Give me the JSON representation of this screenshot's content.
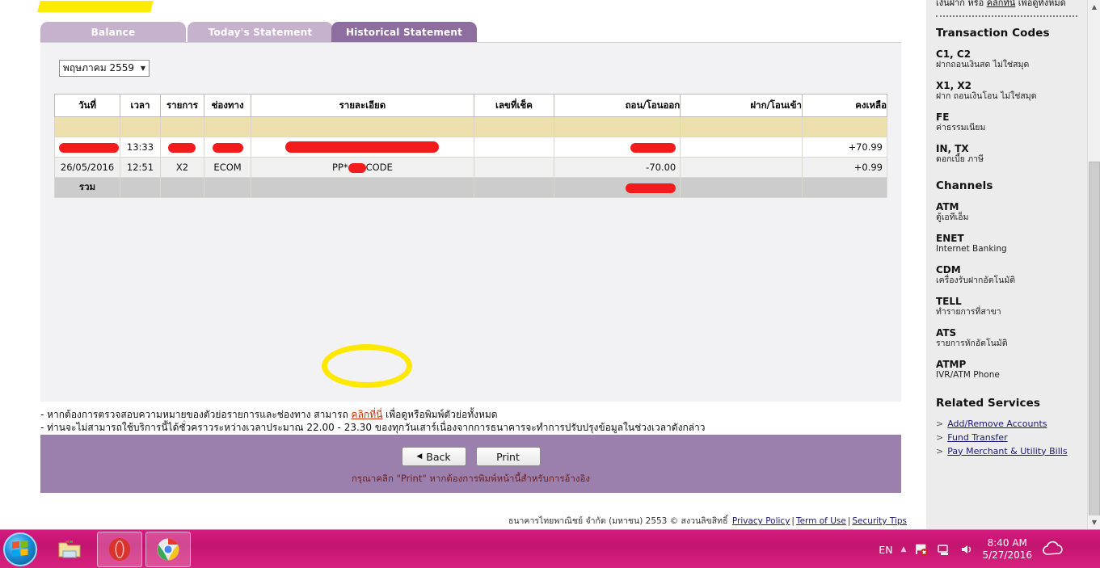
{
  "tabs": [
    {
      "label": "Balance",
      "active": false
    },
    {
      "label": "Today's Statement",
      "active": false
    },
    {
      "label": "Historical Statement",
      "active": true
    }
  ],
  "month_select": {
    "value": "พฤษภาคม 2559",
    "caret": "▼"
  },
  "table": {
    "headers": [
      "วันที่",
      "เวลา",
      "รายการ",
      "ช่องทาง",
      "รายละเอียด",
      "เลขที่เช็ค",
      "ถอน/โอนออก",
      "ฝาก/โอนเข้า",
      "คงเหลือ"
    ],
    "rows": [
      {
        "date": "",
        "time": "13:33",
        "code": "",
        "channel": "",
        "detail": "",
        "cheque": "",
        "out": "",
        "in": "",
        "balance": "+70.99",
        "redacted": [
          "date",
          "code",
          "channel",
          "detail",
          "out"
        ]
      },
      {
        "date": "26/05/2016",
        "time": "12:51",
        "code": "X2",
        "channel": "ECOM",
        "detail_prefix": "PP*",
        "detail_suffix": "CODE",
        "cheque": "",
        "out": "-70.00",
        "in": "",
        "balance": "+0.99",
        "redacted": [
          "detail_middle"
        ]
      }
    ],
    "total_row": {
      "label": "รวม",
      "out": "",
      "redacted": [
        "out"
      ]
    }
  },
  "notes": {
    "line1_pre": "- หากต้องการตรวจสอบความหมายของตัวย่อรายการและช่องทาง สามารถ ",
    "line1_link": "คลิกที่นี่",
    "line1_post": " เพื่อดูหรือพิมพ์ตัวย่อทั้งหมด",
    "line2": "- ท่านจะไม่สามารถใช้บริการนี้ได้ชั่วคราวระหว่างเวลาประมาณ 22.00 - 23.30 ของทุกวันเสาร์เนื่องจากการธนาคารจะทำการปรับปรุงข้อมูลในช่วงเวลาดังกล่าว"
  },
  "footer_panel": {
    "back_label": "Back",
    "back_icon": "triangle-left-icon",
    "print_label": "Print",
    "print_hint": "กรุณาคลิก \"Print\" หากต้องการพิมพ์หน้านี้สำหรับการอ้างอิง"
  },
  "copyright": {
    "text": "ธนาคารไทยพาณิชย์ จำกัด (มหาชน) 2553 © สงวนลิขสิทธิ์",
    "links": [
      "Privacy Policy",
      "Term of Use",
      "Security Tips"
    ],
    "separator": "|"
  },
  "sidebar": {
    "intro_pre": "เงินฝาก หรือ ",
    "intro_link": "คลิกที่นี่",
    "intro_post": " เพื่อดูทั้งหมด",
    "transaction_codes_heading": "Transaction Codes",
    "transaction_codes": [
      {
        "code": "C1, C2",
        "desc": "ฝากถอนเงินสด ไม่ใช่สมุด"
      },
      {
        "code": "X1, X2",
        "desc": "ฝาก ถอนเงินโอน ไม่ใช่สมุด"
      },
      {
        "code": "FE",
        "desc": "ค่าธรรมเนียม"
      },
      {
        "code": "IN, TX",
        "desc": "ดอกเบี้ย ภาษี"
      }
    ],
    "channels_heading": "Channels",
    "channels": [
      {
        "code": "ATM",
        "desc": "ตู้เอทีเอ็ม"
      },
      {
        "code": "ENET",
        "desc": "Internet Banking"
      },
      {
        "code": "CDM",
        "desc": "เครื่องรับฝากอัตโนมัติ"
      },
      {
        "code": "TELL",
        "desc": "ทำรายการที่สาขา"
      },
      {
        "code": "ATS",
        "desc": "รายการหักอัตโนมัติ"
      },
      {
        "code": "ATMP",
        "desc": "IVR/ATM Phone"
      }
    ],
    "related_heading": "Related Services",
    "related_links": [
      "Add/Remove Accounts",
      "Fund Transfer",
      "Pay Merchant & Utility Bills"
    ],
    "related_arrow": ">"
  },
  "scrollbar": {
    "up": "▲",
    "down": "▼"
  },
  "taskbar": {
    "start_icon": "windows-start-icon",
    "buttons": [
      {
        "name": "explorer-icon",
        "label": "",
        "active": false
      },
      {
        "name": "opera-icon",
        "label": "",
        "active": true
      },
      {
        "name": "chrome-icon",
        "label": "",
        "active": true
      }
    ],
    "tray": {
      "language": "EN",
      "caret": "▲",
      "icons": [
        "flag-error-icon",
        "network-icon",
        "volume-icon"
      ],
      "time": "8:40 AM",
      "date": "5/27/2016",
      "cloud_icon": "cloud-icon"
    }
  },
  "colors": {
    "tab_active": "#8d6e9e",
    "tab_inactive": "#c7b2ce",
    "panel_bg": "#f2f2f4",
    "table_fill": "#ede0ac",
    "footer_purple": "#9b80ae",
    "redaction": "#f31b1b",
    "highlight": "#ffe800",
    "taskbar": "#d61a7f"
  }
}
